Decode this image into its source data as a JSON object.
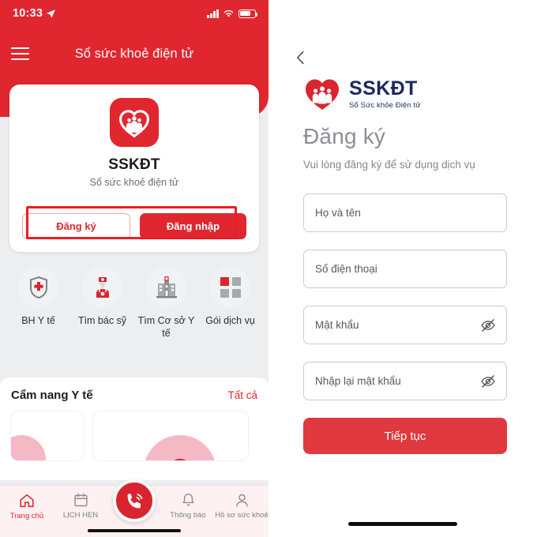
{
  "left_phone": {
    "status_bar": {
      "time": "10:33",
      "location_icon": "location-arrow-icon",
      "signal_icon": "cellular-signal-icon",
      "wifi_icon": "wifi-icon",
      "battery_icon": "battery-icon"
    },
    "navbar": {
      "menu_icon": "hamburger-menu-icon",
      "title": "Sổ sức khoẻ điện tử"
    },
    "auth_card": {
      "app_icon": "sskdt-heart-family-app-icon",
      "app_name": "SSKĐT",
      "app_subtitle": "Sổ sức khoẻ điện tử",
      "register_label": "Đăng ký",
      "login_label": "Đăng nhập"
    },
    "annotation": {
      "shape": "rectangle",
      "color": "#ec1c24"
    },
    "quick_actions": [
      {
        "icon": "shield-red-cross-icon",
        "label": "BH Y tế"
      },
      {
        "icon": "doctor-icon",
        "label": "Tìm bác sỹ"
      },
      {
        "icon": "hospital-icon",
        "label": "Tìm Cơ sở Y tế"
      },
      {
        "icon": "grid-squares-icon",
        "label": "Gói dịch vụ"
      }
    ],
    "guide": {
      "title": "Cẩm nang Y tế",
      "see_all": "Tất cả"
    },
    "tabbar": [
      {
        "icon": "home-icon",
        "label": "Trang chủ",
        "active": true
      },
      {
        "icon": "calendar-icon",
        "label": "LỊCH HẸN",
        "active": false
      },
      {
        "icon": "phone-call-icon",
        "label": "",
        "active": false
      },
      {
        "icon": "bell-icon",
        "label": "Thông báo",
        "active": false
      },
      {
        "icon": "person-icon",
        "label": "Hồ sơ sức khoẻ",
        "active": false
      }
    ]
  },
  "right_phone": {
    "back_icon": "chevron-left-icon",
    "brand": {
      "logo_icon": "sskdt-heart-family-logo",
      "name": "SSKĐT",
      "tagline": "Sổ Sức khỏe Điện tử"
    },
    "page_title": "Đăng ký",
    "page_subtitle": "Vui lòng đăng ký để sử dụng dịch vụ",
    "fields": [
      {
        "name": "fullname",
        "placeholder": "Họ và tên",
        "value": "",
        "eye": false
      },
      {
        "name": "phone",
        "placeholder": "Số điện thoại",
        "value": "",
        "eye": false
      },
      {
        "name": "password",
        "placeholder": "Mật khẩu",
        "value": "",
        "eye": true,
        "eye_icon": "eye-off-icon"
      },
      {
        "name": "confirm-password",
        "placeholder": "Nhập lại mật khẩu",
        "value": "",
        "eye": true,
        "eye_icon": "eye-off-icon"
      }
    ],
    "submit_label": "Tiếp tục"
  },
  "colors": {
    "brand_red": "#e0262f",
    "button_red": "#e0383f",
    "annotation_red": "#ec1c24",
    "navy": "#1b2a5e"
  }
}
